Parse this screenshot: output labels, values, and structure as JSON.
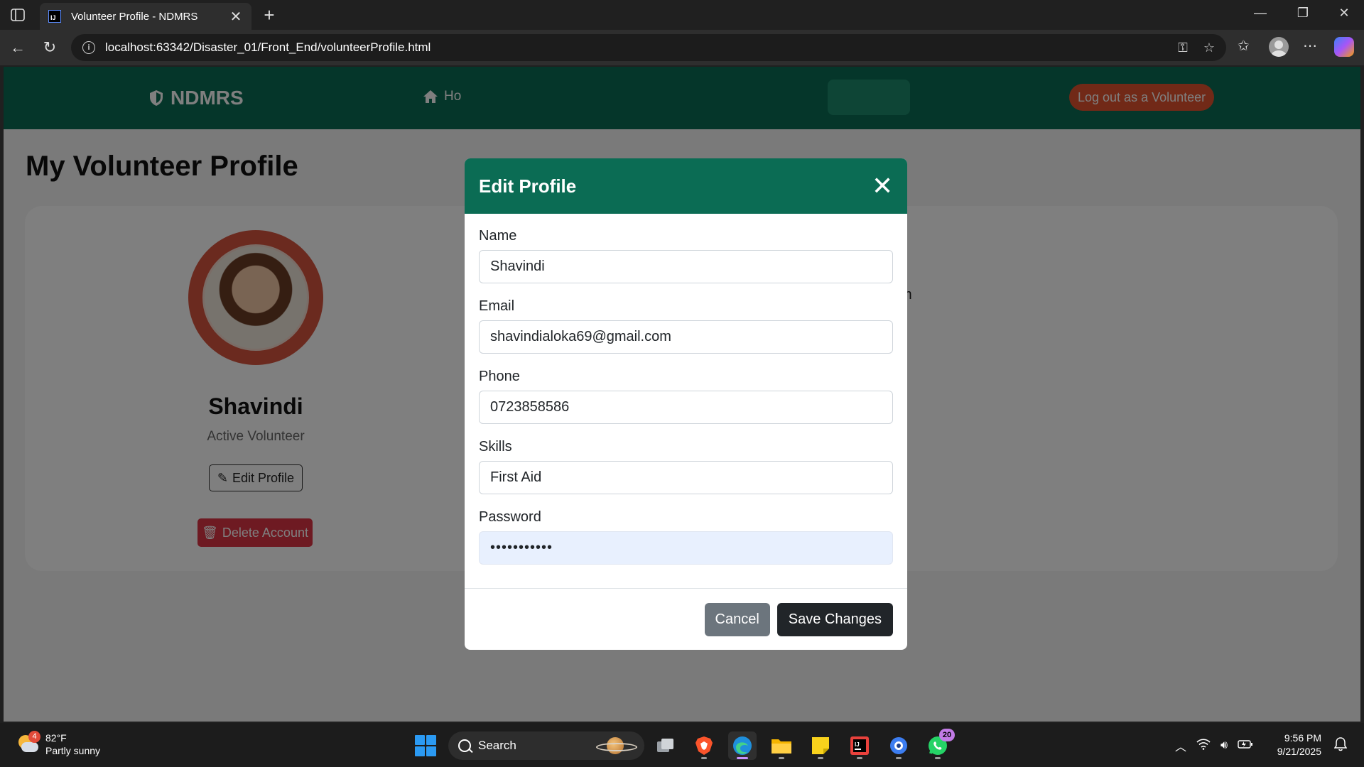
{
  "browser": {
    "tab_title": "Volunteer Profile - NDMRS",
    "tab_favicon_text": "IJ",
    "new_tab_symbol": "+",
    "close_symbol": "✕",
    "url": "localhost:63342/Disaster_01/Front_End/volunteerProfile.html"
  },
  "navbar": {
    "brand": "NDMRS",
    "home_link": "Ho",
    "logout_label": "Log out as a Volunteer",
    "color": "#0b6c54"
  },
  "page": {
    "title": "My Volunteer Profile",
    "fragment_text": "m"
  },
  "profile": {
    "name": "Shavindi",
    "status": "Active Volunteer",
    "edit_label": "Edit Profile",
    "delete_label": "Delete Account"
  },
  "modal": {
    "title": "Edit Profile",
    "close_symbol": "✕",
    "fields": {
      "name": {
        "label": "Name",
        "value": "Shavindi"
      },
      "email": {
        "label": "Email",
        "value": "shavindialoka69@gmail.com"
      },
      "phone": {
        "label": "Phone",
        "value": "0723858586"
      },
      "skills": {
        "label": "Skills",
        "value": "First Aid"
      },
      "password": {
        "label": "Password",
        "value": "•••••••••••"
      }
    },
    "cancel_label": "Cancel",
    "save_label": "Save Changes"
  },
  "taskbar": {
    "weather_temp": "82°F",
    "weather_desc": "Partly sunny",
    "weather_badge": "4",
    "search_label": "Search",
    "whatsapp_badge": "20",
    "time": "9:56 PM",
    "date": "9/21/2025"
  },
  "colors": {
    "primary": "#0b6c54",
    "danger": "#dc3545",
    "logout": "#e2532f",
    "dark": "#212529",
    "secondary": "#6c757d"
  }
}
